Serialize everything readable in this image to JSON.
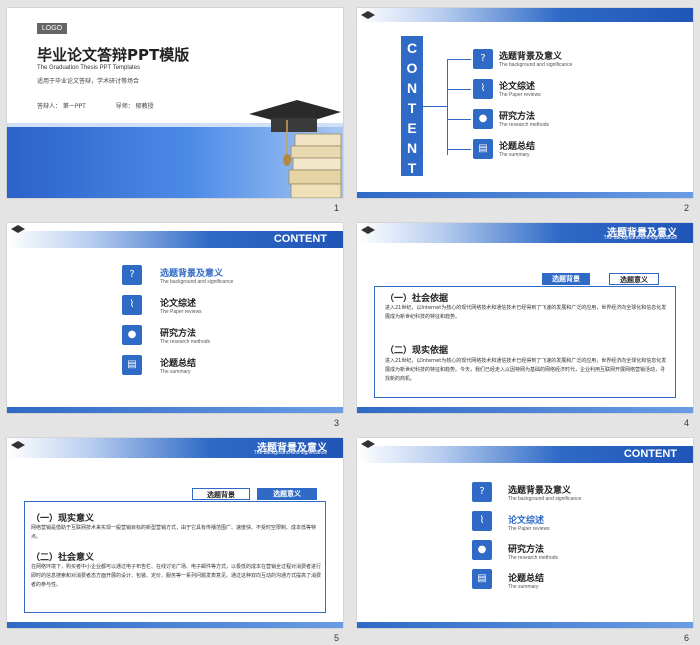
{
  "slide1": {
    "logo": "LOGO",
    "title": "毕业论文答辩PPT模版",
    "subtitle": "The Graduation Thesis PPT Templates",
    "desc": "适用于毕业论文答辩，学术研讨等场合",
    "presenter": "答辩人：  第一PPT",
    "advisor": "导师：  郁教授",
    "num": "1"
  },
  "contents": {
    "content_vertical": [
      "C",
      "O",
      "N",
      "T",
      "E",
      "N",
      "T"
    ],
    "content_label": "CONTENT",
    "items": [
      {
        "title": "选题背景及意义",
        "sub": "The background  and  significance",
        "icon": "question-icon"
      },
      {
        "title": "论文综述",
        "sub": "The Paper reviews",
        "icon": "paperclip-icon"
      },
      {
        "title": "研究方法",
        "sub": "The research methods",
        "icon": "lightbulb-icon"
      },
      {
        "title": "论题总结",
        "sub": "The summary",
        "icon": "document-icon"
      }
    ]
  },
  "slide2": {
    "num": "2"
  },
  "slide3": {
    "num": "3"
  },
  "slide4": {
    "header_title": "选题背景及意义",
    "header_sub": "The background  and  significance",
    "tab1": "选题背景",
    "tab2": "选题意义",
    "sec1": "（一）社会依据",
    "sec1_text": "进入21世纪，以Internet为核心的现代网络技术和通信技术已经得到了飞速的发展和广泛的应用，世界经济向全球化和信息化发展成为新世纪科技的特征和趋势。",
    "sec2": "（二）现实依据",
    "sec2_text": "进入21世纪，以Internet为核心的现代网络技术和通信技术已经得到了飞速的发展和广泛的应用，世界经济向全球化和信息化发展成为新世纪科技的特征和趋势。今天，我们已经走入以因特网为基础的网络经济时代，企业利用互联网开展网络营销活动，寻找新的商机。",
    "num": "4"
  },
  "slide5": {
    "header_title": "选题背景及意义",
    "header_sub": "The background  and  significance",
    "tab1": "选题背景",
    "tab2": "选题意义",
    "sec1": "（一）现实意义",
    "sec1_text": "网络营销是借助于互联网技术来实现一般营销目标的新型营销方式，由于它具有传播范围广、速度快、不受时空限制、成本低等特点。",
    "sec2": "（二）社会意义",
    "sec2_text": "在网络环境下，购买者中小企业都可以通过电子布告栏、在线讨论广场、电子邮件等方式，以极低的成本在营销全过程对消费者进行即时的信息搜索和对消费者态方面开展的设计、包装、定价、服务等一系列问题发表意见。通过这种双向互动的沟通方式提高了消费者的参与性。",
    "num": "5"
  },
  "slide6": {
    "num": "6"
  },
  "colors": {
    "accent": "#2f6ac6"
  }
}
